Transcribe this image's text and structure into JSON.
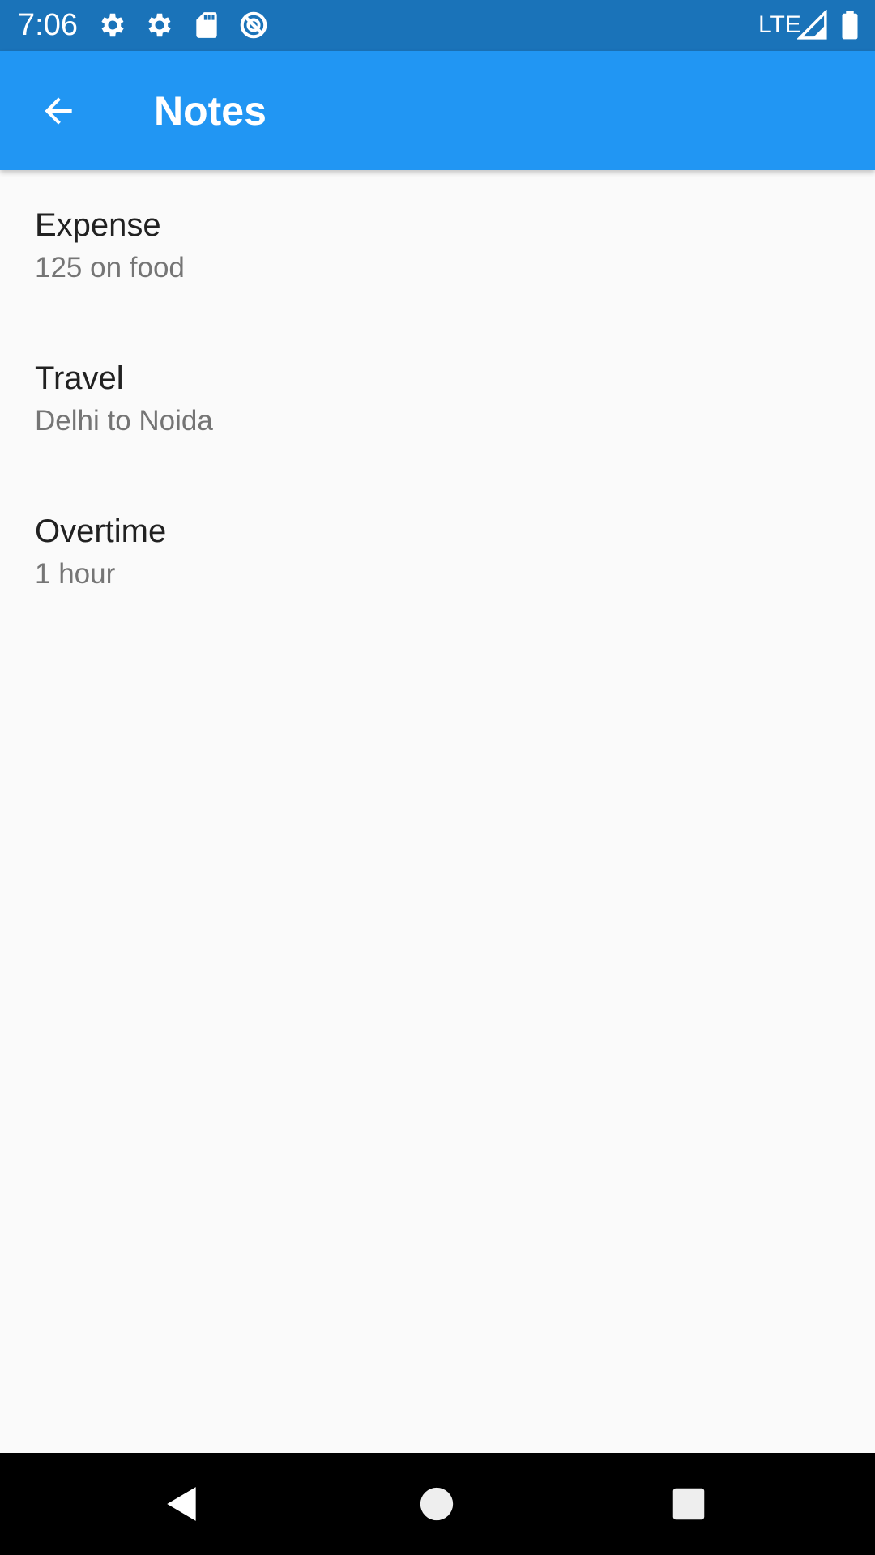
{
  "status_bar": {
    "time": "7:06",
    "network": "LTE",
    "icons": [
      "gear-icon",
      "gear-icon",
      "sd-card-icon",
      "do-not-disturb-icon",
      "signal-icon",
      "battery-icon"
    ],
    "background_color": "#1a73b9"
  },
  "app_bar": {
    "title": "Notes",
    "back_icon": "arrow-left-icon",
    "background_color": "#2196f3"
  },
  "notes": [
    {
      "title": "Expense",
      "subtitle": "125 on food"
    },
    {
      "title": "Travel",
      "subtitle": "Delhi to Noida"
    },
    {
      "title": "Overtime",
      "subtitle": "1 hour"
    }
  ],
  "nav_bar": {
    "buttons": [
      "back-triangle-icon",
      "home-circle-icon",
      "recents-square-icon"
    ]
  }
}
